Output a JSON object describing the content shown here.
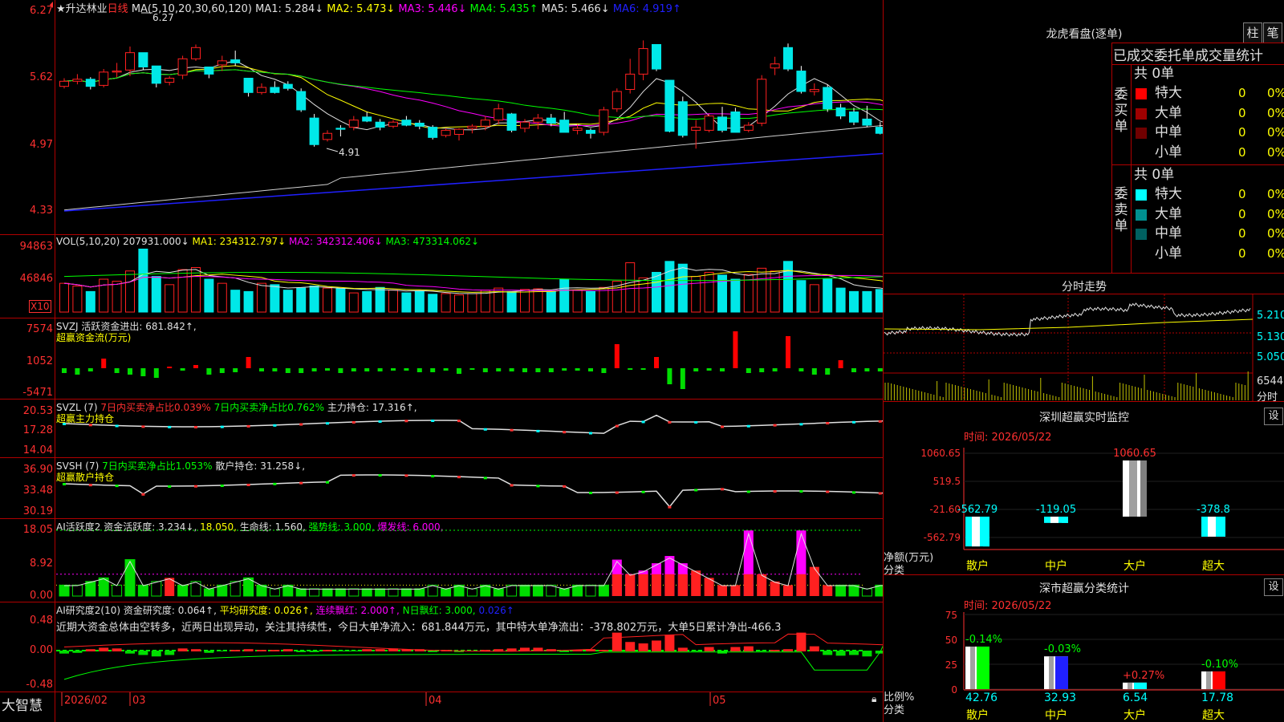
{
  "stock": {
    "name": "★升达林业",
    "period": "日线",
    "ma_label": "MA(5,10,20,30,60,120)",
    "ma": [
      {
        "text": "MA1: 5.284↓",
        "color": "#e0e0e0"
      },
      {
        "text": "MA2: 5.473↓",
        "color": "#ffff00"
      },
      {
        "text": "MA3: 5.446↓",
        "color": "#ff00ff"
      },
      {
        "text": "MA4: 5.435↑",
        "color": "#00ff00"
      },
      {
        "text": "MA5: 5.466↓",
        "color": "#e0e0e0"
      },
      {
        "text": "MA6: 4.919↑",
        "color": "#2020ff"
      }
    ],
    "high_mark": "6.27",
    "low_mark": "4.91",
    "price_axis": [
      "6.27",
      "5.62",
      "4.97",
      "4.33"
    ]
  },
  "vol": {
    "label": "VOL(5,10,20)",
    "values": [
      {
        "text": "207931.000↓",
        "color": "#e0e0e0"
      },
      {
        "text": "MA1: 234312.797↓",
        "color": "#ffff00"
      },
      {
        "text": "MA2: 342312.406↓",
        "color": "#ff00ff"
      },
      {
        "text": "MA3: 473314.062↓",
        "color": "#00ff00"
      }
    ],
    "axis": [
      "94863",
      "46846"
    ],
    "unit": "X10"
  },
  "svzj": {
    "label": "SVZJ  活跃资金进出: 681.842↑,",
    "sub": "超赢资金流(万元)",
    "axis": [
      "7574",
      "1052",
      "-5471"
    ]
  },
  "svzl": {
    "label": "SVZL (7)",
    "v1": "7日内买卖净占比0.039%",
    "v2": "7日内买卖净占比0.762%",
    "v3": "主力持仓: 17.316↑,",
    "sub": "超赢主力持仓",
    "axis": [
      "20.53",
      "17.28",
      "14.04"
    ]
  },
  "svsh": {
    "label": "SVSH (7)",
    "v1": "7日内买卖净占比1.053%",
    "v2": "散户持仓: 31.258↓,",
    "sub": "超赢散户持仓",
    "axis": [
      "36.90",
      "33.48",
      "30.19"
    ]
  },
  "ai1": {
    "label": "AI活跃度2 资金活跃度: 3.234↓,",
    "v1": "18.050,",
    "v2": "生命线: 1.560,",
    "v3": "强势线: 3.000,",
    "v4": "爆发线: 6.000,",
    "axis": [
      "18.05",
      "8.92",
      "0.00"
    ]
  },
  "ai2": {
    "label": "AI研究度2(10) 资金研究度: 0.064↑,",
    "v1": "平均研究度: 0.026↑,",
    "v2": "连续飘红: 2.000↑,",
    "v3": "N日飘红: 3.000,",
    "v4": "0.026↑",
    "comment": "近期大资金总体由空转多，近两日出现异动，关注其持续性，今日大单净流入：681.844万元，其中特大单净流出：-378.802万元，大单5日累计净出-466.3",
    "axis": [
      "0.48",
      "0.00",
      "-0.48"
    ]
  },
  "xaxis": {
    "brand": "大智慧",
    "labels": [
      "2026/02",
      "03",
      "04",
      "05"
    ]
  },
  "right": {
    "title": "龙虎看盘(逐单)",
    "tab_a": "柱",
    "tab_b": "笔",
    "table_header": "已成交委托单成交量统计",
    "buy_side": "委买单",
    "sell_side": "委卖单",
    "total": "共 0单",
    "rows": [
      {
        "name": "特大",
        "count": "0",
        "pct": "0%"
      },
      {
        "name": "大单",
        "count": "0",
        "pct": "0%"
      },
      {
        "name": "中单",
        "count": "0",
        "pct": "0%"
      },
      {
        "name": "小单",
        "count": "0",
        "pct": "0%"
      }
    ],
    "buy_colors": [
      "#ff0000",
      "#a00000",
      "#700000",
      "#000000"
    ],
    "sell_colors": [
      "#00ffff",
      "#009090",
      "#006060",
      "#000000"
    ],
    "mini_title": "分时走势",
    "mini_axis": [
      "5.210",
      "5.130",
      "5.050"
    ],
    "mini_vol": "6544",
    "mini_vol_unit": "分时",
    "sz_title": "深圳超赢实时监控",
    "set": "设",
    "time": "时间: 2026/05/22",
    "sz_axis": [
      "1060.65",
      "519.5",
      "-21.60",
      "-562.79"
    ],
    "sz_ylabel": "净额(万元)",
    "sz_xlabel": "分类",
    "sz_bars": [
      {
        "cat": "散户",
        "value": "-562.79"
      },
      {
        "cat": "中户",
        "value": "-119.05"
      },
      {
        "cat": "大户",
        "value": "1060.65"
      },
      {
        "cat": "超大",
        "value": "-378.8"
      }
    ],
    "cls_title": "深市超赢分类统计",
    "cls_axis": [
      "75",
      "50",
      "25",
      "0"
    ],
    "cls_ylabel": "比例%",
    "cls_xlabel": "分类",
    "cls_bars": [
      {
        "cat": "散户",
        "pct": "-0.14%",
        "value": "42.76",
        "color": "#00ff00"
      },
      {
        "cat": "中户",
        "pct": "-0.03%",
        "value": "32.93",
        "color": "#2020ff"
      },
      {
        "cat": "大户",
        "pct": "+0.27%",
        "value": "6.54",
        "color": "#00ffff"
      },
      {
        "cat": "超大",
        "pct": "-0.10%",
        "value": "17.78",
        "color": "#ff0000"
      }
    ]
  }
}
